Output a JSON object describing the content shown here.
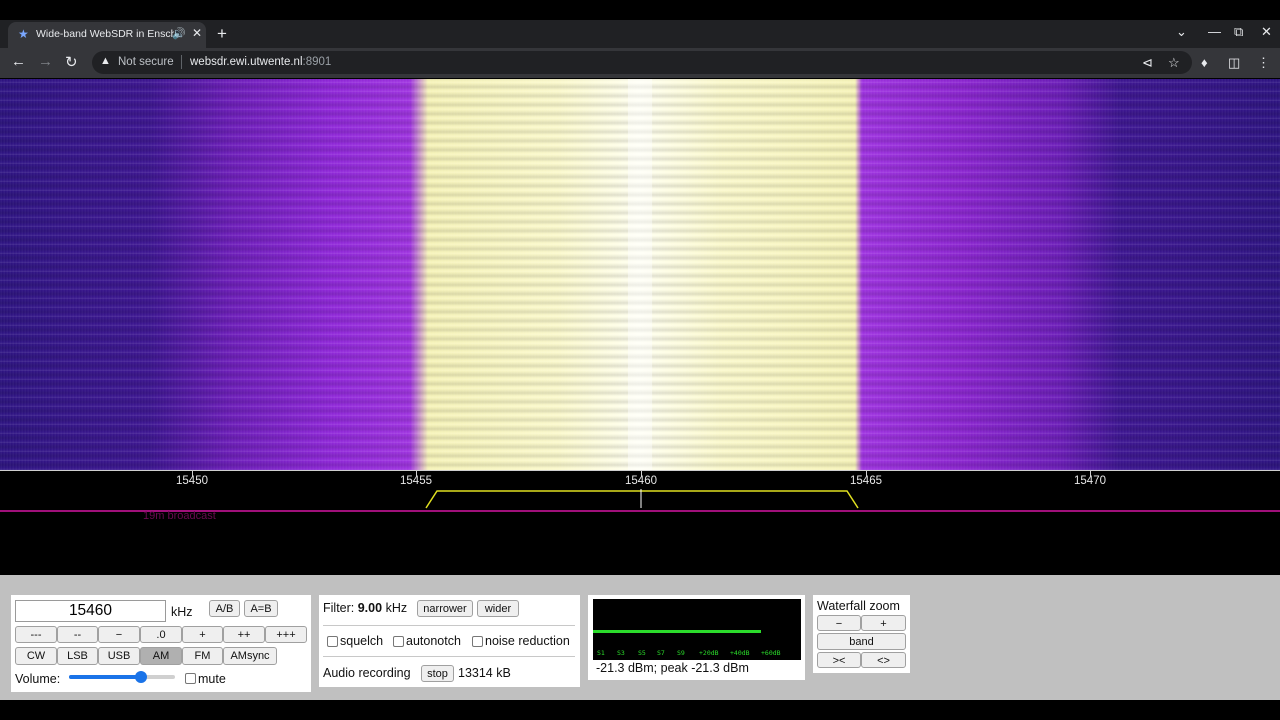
{
  "browser": {
    "tab_title": "Wide-band WebSDR in Ensch",
    "new_tab": "+",
    "security_label": "Not secure",
    "url_host": "websdr.ewi.utwente.nl",
    "url_port": ":8901"
  },
  "waterfall": {
    "scale_labels": [
      "15450",
      "15455",
      "15460",
      "15465",
      "15470"
    ],
    "band_label": "19m broadcast",
    "colors": {
      "low": "#2a1080",
      "mid": "#9d30e0",
      "high": "#fbf9cc",
      "passband": "#e0e020",
      "band_line": "#a0107a"
    }
  },
  "tuning": {
    "frequency": "15460",
    "unit": "kHz",
    "ab_label": "A/B",
    "aeqb_label": "A=B",
    "step_buttons": [
      "---",
      "--",
      "−",
      ".0",
      "+",
      "++",
      "+++"
    ],
    "modes": [
      "CW",
      "LSB",
      "USB",
      "AM",
      "FM",
      "AMsync"
    ],
    "selected_mode": "AM",
    "volume_label": "Volume:",
    "volume_level": 0.68,
    "mute_label": "mute"
  },
  "filter": {
    "label": "Filter:",
    "value": "9.00",
    "unit": "kHz",
    "narrower": "narrower",
    "wider": "wider",
    "squelch": "squelch",
    "autonotch": "autonotch",
    "noise_reduction": "noise reduction",
    "audio_recording": "Audio recording",
    "stop": "stop",
    "rec_size": "13314 kB"
  },
  "meter": {
    "reading": "-21.3 dBm; peak  -21.3 dBm",
    "scale_labels": [
      "S1",
      "S3",
      "S5",
      "S7",
      "S9",
      "+20dB",
      "+40dB",
      "+60dB"
    ],
    "level": 0.81
  },
  "zoom": {
    "title": "Waterfall zoom",
    "minus": "−",
    "plus": "+",
    "band": "band",
    "left_right": "><",
    "right_left": "<>"
  }
}
